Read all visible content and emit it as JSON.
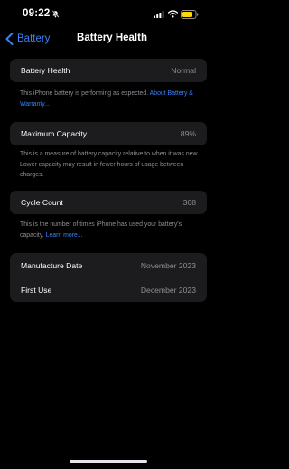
{
  "status_bar": {
    "time": "09:22"
  },
  "colors": {
    "background": "#000000",
    "card": "#1c1c1e",
    "accent": "#3b82f6",
    "secondary_text": "#8e8e93",
    "battery_fill": "#ffd60a"
  },
  "nav": {
    "back_label": "Battery",
    "title": "Battery Health"
  },
  "battery_health": {
    "label": "Battery Health",
    "value": "Normal",
    "footer_text": "This iPhone battery is performing as expected. ",
    "footer_link": "About Battery & Warranty..."
  },
  "maximum_capacity": {
    "label": "Maximum Capacity",
    "value": "89%",
    "footer_text": "This is a measure of battery capacity relative to when it was new. Lower capacity may result in fewer hours of usage between charges."
  },
  "cycle_count": {
    "label": "Cycle Count",
    "value": "368",
    "footer_text": "This is the number of times iPhone has used your battery's capacity. ",
    "footer_link": "Learn more..."
  },
  "dates": {
    "manufacture_label": "Manufacture Date",
    "manufacture_value": "November 2023",
    "first_use_label": "First Use",
    "first_use_value": "December 2023"
  },
  "icons": {
    "focus": "bell-slash-icon",
    "signal": "cellular-signal-icon",
    "wifi": "wifi-icon",
    "battery": "battery-icon",
    "back": "chevron-left-icon"
  }
}
